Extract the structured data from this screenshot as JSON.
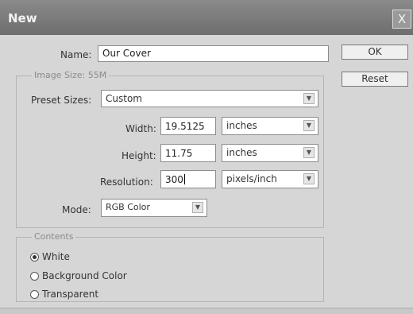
{
  "window": {
    "title": "New",
    "close_glyph": "X"
  },
  "name": {
    "label": "Name:",
    "value": "Our Cover"
  },
  "image_size": {
    "label": "Image Size: 55M"
  },
  "preset": {
    "label": "Preset Sizes:",
    "value": "Custom"
  },
  "width": {
    "label": "Width:",
    "value": "19.5125",
    "unit": "inches"
  },
  "height": {
    "label": "Height:",
    "value": "11.75",
    "unit": "inches"
  },
  "resolution": {
    "label": "Resolution:",
    "value": "300",
    "unit": "pixels/inch"
  },
  "mode": {
    "label": "Mode:",
    "value": "RGB Color"
  },
  "contents": {
    "label": "Contents",
    "options": [
      {
        "label": "White",
        "checked": true
      },
      {
        "label": "Background Color",
        "checked": false
      },
      {
        "label": "Transparent",
        "checked": false
      }
    ]
  },
  "buttons": {
    "ok": "OK",
    "reset": "Reset"
  },
  "icons": {
    "dropdown": "chevron-down-icon",
    "close": "close-icon",
    "radio": "radio-icon"
  }
}
